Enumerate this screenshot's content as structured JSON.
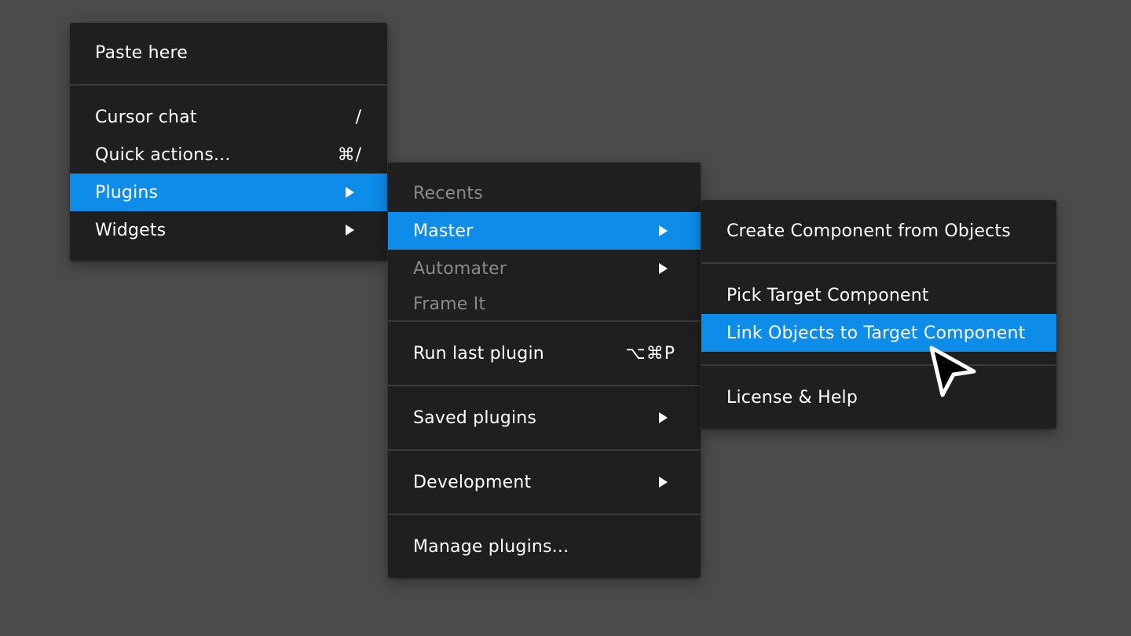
{
  "colors": {
    "background": "#4b4b4b",
    "menu_bg": "#1f1f1f",
    "highlight": "#0d8ce9",
    "dim_text": "#8a8a8a"
  },
  "main_menu": {
    "paste_here": "Paste here",
    "cursor_chat": {
      "label": "Cursor chat",
      "shortcut": "/"
    },
    "quick_actions": {
      "label": "Quick actions...",
      "shortcut": "⌘/"
    },
    "plugins": {
      "label": "Plugins",
      "icon": "chevron-right-icon"
    },
    "widgets": {
      "label": "Widgets",
      "icon": "chevron-right-icon"
    }
  },
  "plugins_menu": {
    "recents": "Recents",
    "master": "Master",
    "automater": "Automater",
    "frame_it": "Frame It",
    "run_last_plugin": {
      "label": "Run last plugin",
      "shortcut": "⌥⌘P"
    },
    "saved_plugins": "Saved plugins",
    "development": "Development",
    "manage_plugins": "Manage plugins..."
  },
  "master_menu": {
    "create_component": "Create Component from Objects",
    "pick_target": "Pick Target Component",
    "link_objects": "Link Objects to Target Component",
    "license_help": "License & Help"
  },
  "cursor": {
    "icon": "pointer-cursor-icon"
  }
}
